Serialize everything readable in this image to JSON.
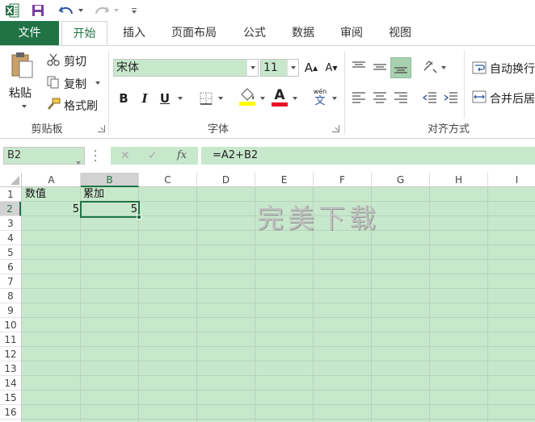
{
  "app": {
    "tabs": [
      {
        "label": "文件"
      },
      {
        "label": "开始"
      },
      {
        "label": "插入"
      },
      {
        "label": "页面布局"
      },
      {
        "label": "公式"
      },
      {
        "label": "数据"
      },
      {
        "label": "审阅"
      },
      {
        "label": "视图"
      }
    ]
  },
  "ribbon": {
    "clipboard": {
      "paste_label": "粘贴",
      "cut_label": "剪切",
      "copy_label": "复制",
      "format_painter_label": "格式刷",
      "group_label": "剪贴板"
    },
    "font": {
      "font_name": "宋体",
      "font_size": "11",
      "group_label": "字体",
      "grow_label": "A",
      "shrink_label": "A",
      "bold_label": "B",
      "italic_label": "I",
      "underline_label": "U",
      "font_color_label": "A",
      "phonetic_top": "wén",
      "phonetic_bottom": "文"
    },
    "alignment": {
      "wrap_text_label": "自动换行",
      "merge_label": "合并后居",
      "group_label": "对齐方式"
    }
  },
  "formula_bar": {
    "name_box": "B2",
    "fx_label": "fx",
    "formula": "=A2+B2"
  },
  "sheet": {
    "columns": [
      "A",
      "B",
      "C",
      "D",
      "E",
      "F",
      "G",
      "H",
      "I"
    ],
    "rows": [
      "1",
      "2",
      "3",
      "4",
      "5",
      "6",
      "7",
      "8",
      "9",
      "10",
      "11",
      "12",
      "13",
      "14",
      "15",
      "16"
    ],
    "selected_cell": "B2",
    "cells": {
      "A1": "数值",
      "B1": "累加",
      "A2": "5",
      "B2": "5"
    }
  },
  "watermark": "完美下载",
  "colors": {
    "accent": "#217346",
    "sheet_bg": "#c8e8cc",
    "font_color_bar": "#e81123",
    "highlight_bar": "#ffff00"
  }
}
